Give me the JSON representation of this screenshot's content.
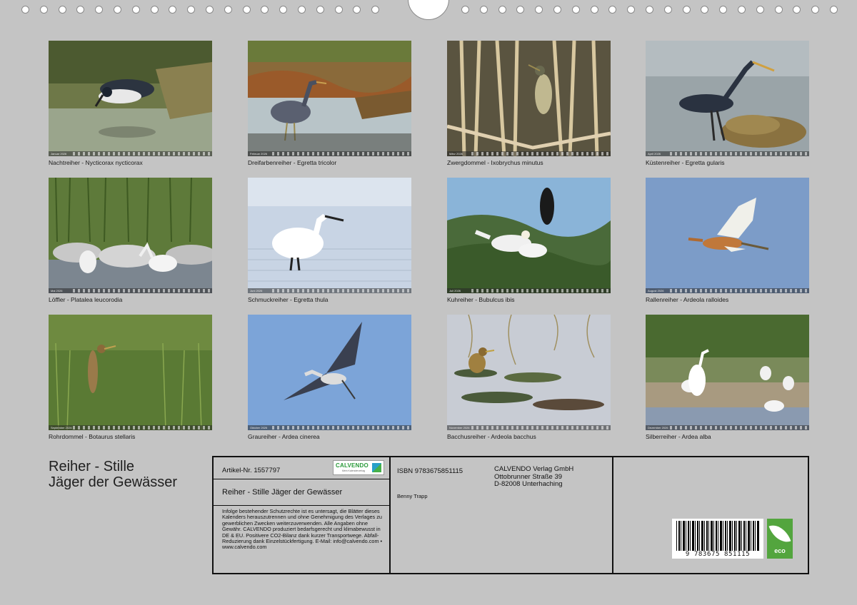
{
  "colors": {
    "background": "#c4c4c4",
    "accent_green": "#53a53e"
  },
  "photos": [
    {
      "month": "Januar 2026",
      "caption": "Nachtreiher - Nycticorax nycticorax"
    },
    {
      "month": "Februar 2026",
      "caption": "Dreifarbenreiher - Egretta tricolor"
    },
    {
      "month": "März 2026",
      "caption": "Zwergdommel - Ixobrychus minutus"
    },
    {
      "month": "April 2026",
      "caption": "Küstenreiher - Egretta gularis"
    },
    {
      "month": "Mai 2026",
      "caption": "Löffler - Platalea leucorodia"
    },
    {
      "month": "Juni 2026",
      "caption": "Schmuckreiher - Egretta thula"
    },
    {
      "month": "Juli 2026",
      "caption": "Kuhreiher - Bubulcus ibis"
    },
    {
      "month": "August 2026",
      "caption": "Rallenreiher - Ardeola ralloides"
    },
    {
      "month": "September 2026",
      "caption": "Rohrdommel - Botaurus stellaris"
    },
    {
      "month": "Oktober 2026",
      "caption": "Graureiher - Ardea cinerea"
    },
    {
      "month": "November 2026",
      "caption": "Bacchusreiher - Ardeola bacchus"
    },
    {
      "month": "Dezember 2026",
      "caption": "Silberreiher - Ardea alba"
    }
  ],
  "title": {
    "line1": "Reiher - Stille",
    "line2": "Jäger der Gewässer"
  },
  "info": {
    "article": "Artikel-Nr. 1557797",
    "logo_text": "CALVENDO",
    "logo_sub": "Mein Kalenderverlag",
    "product_title": "Reiher - Stille Jäger der Gewässer",
    "legal": "Infolge bestehender Schutzrechte ist es untersagt, die Blätter dieses Kalenders herauszutrennen und ohne Genehmigung des Verlages zu gewerblichen Zwecken weiterzuverwenden. Alle Angaben ohne Gewähr. CALVENDO produziert bedarfsgerecht und klimabewusst in DE & EU. Positivere CO2-Bilanz dank kurzer Transportwege. Abfall-Reduzierung dank Einzelstückfertigung. E-Mail: info@calvendo.com • www.calvendo.com",
    "isbn": "ISBN 9783675851115",
    "author": "Benny Trapp",
    "publisher_line1": "CALVENDO Verlag GmbH",
    "publisher_line2": "Ottobrunner Straße 39",
    "publisher_line3": "D-82008 Unterhaching",
    "barcode_number": "9 783675 851115",
    "eco_label": "eco"
  }
}
